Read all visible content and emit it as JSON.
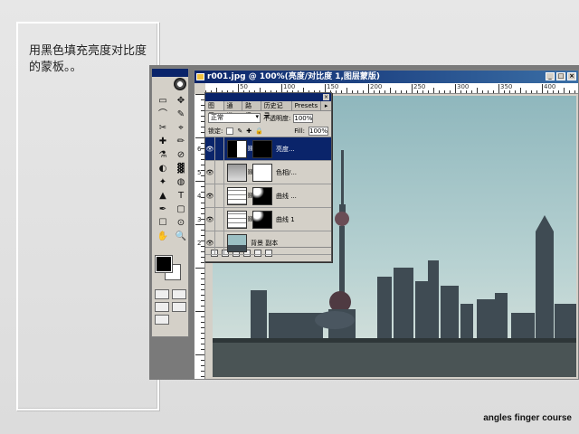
{
  "note": {
    "text": "用黑色填充亮度对比度的蒙板。。"
  },
  "footer": "angles finger course",
  "document": {
    "title": "r001.jpg @ 100%(亮度/对比度 1,图层蒙版)"
  },
  "ruler": {
    "numbers": [
      "50",
      "100",
      "150",
      "200",
      "250",
      "300",
      "350",
      "400"
    ]
  },
  "layers_panel": {
    "tabs": [
      "图层",
      "通道",
      "路径",
      "历史记录",
      "Presets"
    ],
    "blend_mode": "正常",
    "opacity_label": "不透明度:",
    "opacity_value": "100%",
    "lock_label": "锁定:",
    "fill_label": "Fill:",
    "fill_value": "100%",
    "layers": [
      {
        "index": "6",
        "name": "亮度...",
        "selected": true
      },
      {
        "index": "5",
        "name": "色相/...",
        "selected": false
      },
      {
        "index": "4",
        "name": "曲线 ...",
        "selected": false
      },
      {
        "index": "3",
        "name": "曲线 1",
        "selected": false
      },
      {
        "index": "2",
        "name": "背景 副本",
        "selected": false
      }
    ]
  },
  "toolbox": {
    "tools": [
      "▭",
      "✥",
      "⌒",
      "✎",
      "✂",
      "⌖",
      "✚",
      "✏",
      "⚗",
      "⊘",
      "◐",
      "▓",
      "✦",
      "◍",
      "▲",
      "T",
      "✒",
      "▢",
      "☐",
      "⊙",
      "✋",
      "🔍"
    ]
  },
  "colors": {
    "foreground": "#000000",
    "background": "#ffffff",
    "titlebar": "#0a246a"
  }
}
